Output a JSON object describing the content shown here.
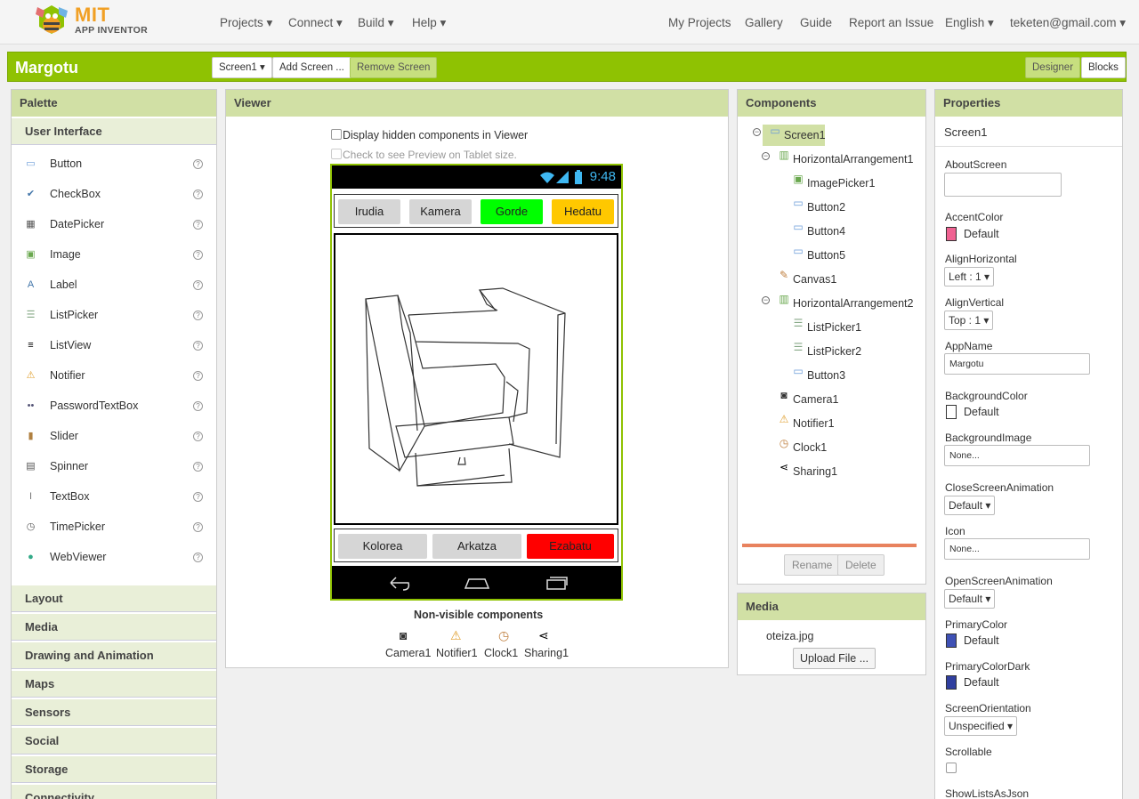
{
  "app": {
    "logo_mit": "MIT",
    "logo_sub": "APP INVENTOR"
  },
  "nav": {
    "projects": "Projects ▾",
    "connect": "Connect ▾",
    "build": "Build ▾",
    "help": "Help ▾",
    "my_projects": "My Projects",
    "gallery": "Gallery",
    "guide": "Guide",
    "report": "Report an Issue",
    "language": "English ▾",
    "account": "teketen@gmail.com ▾"
  },
  "toolbar": {
    "project_name": "Margotu",
    "screen_select": "Screen1 ▾",
    "add_screen": "Add Screen ...",
    "remove_screen": "Remove Screen",
    "designer": "Designer",
    "blocks": "Blocks"
  },
  "palette": {
    "title": "Palette",
    "category_open": "User Interface",
    "items": [
      {
        "label": "Button",
        "icon": "button-icon"
      },
      {
        "label": "CheckBox",
        "icon": "checkbox-icon"
      },
      {
        "label": "DatePicker",
        "icon": "datepicker-icon"
      },
      {
        "label": "Image",
        "icon": "image-icon"
      },
      {
        "label": "Label",
        "icon": "label-icon"
      },
      {
        "label": "ListPicker",
        "icon": "listpicker-icon"
      },
      {
        "label": "ListView",
        "icon": "listview-icon"
      },
      {
        "label": "Notifier",
        "icon": "notifier-icon"
      },
      {
        "label": "PasswordTextBox",
        "icon": "passwordtextbox-icon"
      },
      {
        "label": "Slider",
        "icon": "slider-icon"
      },
      {
        "label": "Spinner",
        "icon": "spinner-icon"
      },
      {
        "label": "TextBox",
        "icon": "textbox-icon"
      },
      {
        "label": "TimePicker",
        "icon": "timepicker-icon"
      },
      {
        "label": "WebViewer",
        "icon": "webviewer-icon"
      }
    ],
    "categories": [
      "Layout",
      "Media",
      "Drawing and Animation",
      "Maps",
      "Sensors",
      "Social",
      "Storage",
      "Connectivity"
    ]
  },
  "viewer": {
    "title": "Viewer",
    "hidden_check": "Display hidden components in Viewer",
    "tablet_check": "Check to see Preview on Tablet size.",
    "status_time": "9:48",
    "row1": [
      {
        "label": "Irudia",
        "bg": "#d6d6d6"
      },
      {
        "label": "Kamera",
        "bg": "#d6d6d6"
      },
      {
        "label": "Gorde",
        "bg": "#00ff00"
      },
      {
        "label": "Hedatu",
        "bg": "#ffc800"
      }
    ],
    "row2": [
      {
        "label": "Kolorea",
        "bg": "#d6d6d6"
      },
      {
        "label": "Arkatza",
        "bg": "#d6d6d6"
      },
      {
        "label": "Ezabatu",
        "bg": "#ff0000"
      }
    ],
    "nonvisible_title": "Non-visible components",
    "nonvisible": [
      "Camera1",
      "Notifier1",
      "Clock1",
      "Sharing1"
    ]
  },
  "components": {
    "title": "Components",
    "tree": [
      "Screen1",
      "HorizontalArrangement1",
      "ImagePicker1",
      "Button2",
      "Button4",
      "Button5",
      "Canvas1",
      "HorizontalArrangement2",
      "ListPicker1",
      "ListPicker2",
      "Button3",
      "Camera1",
      "Notifier1",
      "Clock1",
      "Sharing1"
    ],
    "rename": "Rename",
    "delete": "Delete"
  },
  "media": {
    "title": "Media",
    "file": "oteiza.jpg",
    "upload": "Upload File ..."
  },
  "properties": {
    "title": "Properties",
    "component": "Screen1",
    "about_label": "AboutScreen",
    "accent_label": "AccentColor",
    "accent_value": "Default",
    "accent_color": "#f06292",
    "alignh_label": "AlignHorizontal",
    "alignh_value": "Left : 1 ▾",
    "alignv_label": "AlignVertical",
    "alignv_value": "Top : 1 ▾",
    "appname_label": "AppName",
    "appname_value": "Margotu",
    "bgcolor_label": "BackgroundColor",
    "bgcolor_value": "Default",
    "bgcolor_color": "#ffffff",
    "bgimage_label": "BackgroundImage",
    "bgimage_value": "None...",
    "close_anim_label": "CloseScreenAnimation",
    "close_anim_value": "Default ▾",
    "icon_label": "Icon",
    "icon_value": "None...",
    "open_anim_label": "OpenScreenAnimation",
    "open_anim_value": "Default ▾",
    "primary_label": "PrimaryColor",
    "primary_value": "Default",
    "primary_color": "#3f51b5",
    "primary_dark_label": "PrimaryColorDark",
    "primary_dark_value": "Default",
    "primary_dark_color": "#303f9f",
    "orientation_label": "ScreenOrientation",
    "orientation_value": "Unspecified ▾",
    "scrollable_label": "Scrollable",
    "showlists_label": "ShowListsAsJson"
  }
}
